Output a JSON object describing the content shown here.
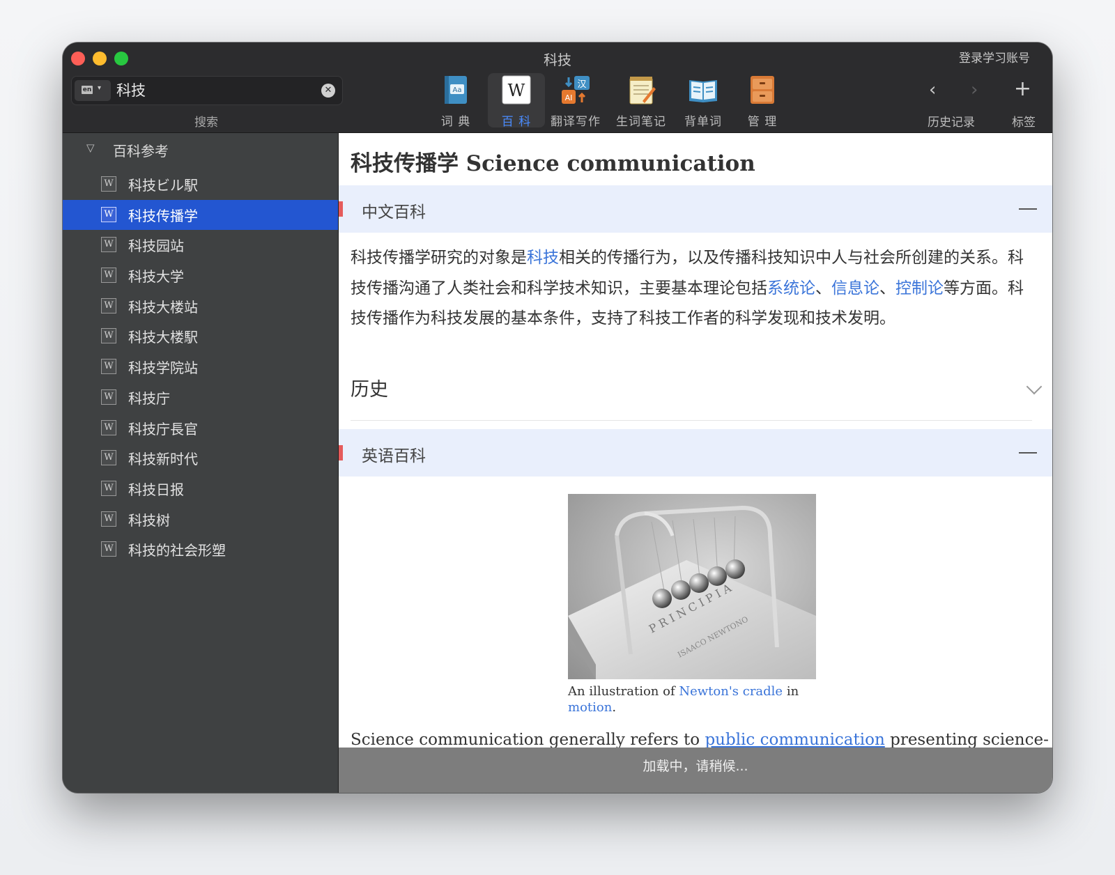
{
  "window": {
    "title": "科技",
    "login_label": "登录学习账号"
  },
  "search": {
    "lang_code": "en",
    "value": "科技",
    "label": "搜索"
  },
  "toolbar": {
    "tools": [
      {
        "id": "dictionary",
        "label": "词 典",
        "icon": "dictionary-book-icon"
      },
      {
        "id": "encyclopedia",
        "label": "百 科",
        "icon": "wikipedia-icon"
      },
      {
        "id": "translate",
        "label": "翻译写作",
        "icon": "ai-translate-icon"
      },
      {
        "id": "notes",
        "label": "生词笔记",
        "icon": "notepad-icon"
      },
      {
        "id": "vocab",
        "label": "背单词",
        "icon": "open-book-icon"
      },
      {
        "id": "manage",
        "label": "管 理",
        "icon": "cabinet-icon"
      }
    ],
    "active_tool": "encyclopedia",
    "history_label": "历史记录",
    "bookmark_label": "标签"
  },
  "sidebar": {
    "group": "百科参考",
    "items": [
      "科技ビル駅",
      "科技传播学",
      "科技园站",
      "科技大学",
      "科技大楼站",
      "科技大楼駅",
      "科技学院站",
      "科技庁",
      "科技庁長官",
      "科技新时代",
      "科技日报",
      "科技树",
      "科技的社会形塑"
    ],
    "selected_index": 1
  },
  "article": {
    "title": "科技传播学 Science communication",
    "zh_section": "中文百科",
    "zh_text": {
      "p1": "科技传播学研究的对象是",
      "l1": "科技",
      "p2": "相关的传播行为，以及传播科技知识中人与社会所创建的关系。科技传播沟通了人类社会和科学技术知识，主要基本理论包括",
      "l2": "系统论",
      "s1": "、",
      "l3": "信息论",
      "s2": "、",
      "l4": "控制论",
      "p3": "等方面。科技传播作为科技发展的基本条件，支持了科技工作者的科学发现和技术发明。"
    },
    "history_heading": "历史",
    "en_section": "英语百科",
    "caption": {
      "t1": "An illustration of ",
      "l1": "Newton's cradle",
      "t2": " in ",
      "l2": "motion",
      "t3": "."
    },
    "en_text": {
      "t1": "Science communication generally refers to ",
      "l1": "public communication",
      "t2": " presenting science-"
    },
    "loading": "加载中，请稍候..."
  },
  "colors": {
    "accent": "#2356d1",
    "link": "#3a74d9",
    "section_bg": "#e9effc",
    "section_marker": "#e55b5b"
  }
}
